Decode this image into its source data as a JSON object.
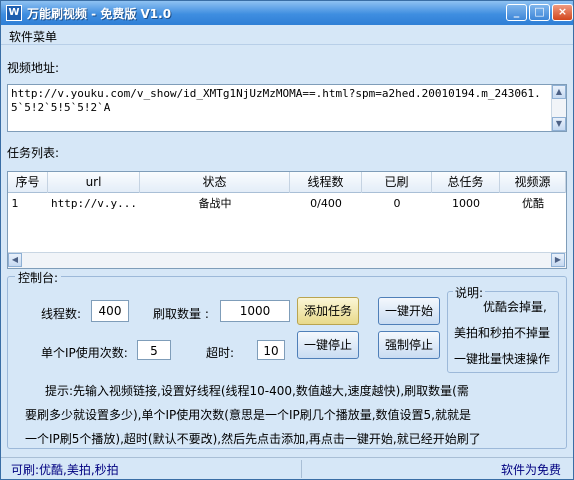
{
  "window": {
    "icon_letter": "W",
    "title": "万能刷视频 - 免费版 V1.0",
    "btn_minimize": "_",
    "btn_maximize": "□",
    "btn_close": "×"
  },
  "menu": {
    "item": "软件菜单"
  },
  "video_url": {
    "label": "视频地址:",
    "value": "http://v.youku.com/v_show/id_XMTg1NjUzMzMOMA==.html?spm=a2hed.20010194.m_243061.5`5!2`5!5`5!2`A"
  },
  "task_list": {
    "label": "任务列表:",
    "columns": [
      "序号",
      "url",
      "状态",
      "线程数",
      "已刷",
      "总任务",
      "视频源"
    ],
    "rows": [
      {
        "index": "1",
        "url": "http://v.y...",
        "status": "备战中",
        "threads": "0/400",
        "done": "0",
        "total": "1000",
        "source": "优酷"
      }
    ]
  },
  "control": {
    "legend": "控制台:",
    "threads_label": "线程数:",
    "threads_value": "400",
    "count_label": "刷取数量 :",
    "count_value": "1000",
    "per_ip_label": "单个IP使用次数:",
    "per_ip_value": "5",
    "timeout_label": "超时:",
    "timeout_value": "10",
    "btn_add": "添加任务",
    "btn_start": "一键开始",
    "btn_stop": "一键停止",
    "btn_force_stop": "强制停止"
  },
  "note": {
    "legend": "说明:",
    "lines": [
      "优酷会掉量,",
      "美拍和秒拍不掉量",
      "一键批量快速操作"
    ]
  },
  "hint": {
    "lines": [
      "提示:先输入视频链接,设置好线程(线程10-400,数值越大,速度越快),刷取数量(需",
      "要刷多少就设置多少),单个IP使用次数(意思是一个IP刷几个播放量,数值设置5,就就是",
      "一个IP刷5个播放),超时(默认不要改),然后先点击添加,再点击一键开始,就已经开始刷了"
    ]
  },
  "status": {
    "left": "可刷:优酷,美拍,秒拍",
    "right": "软件为免费"
  }
}
